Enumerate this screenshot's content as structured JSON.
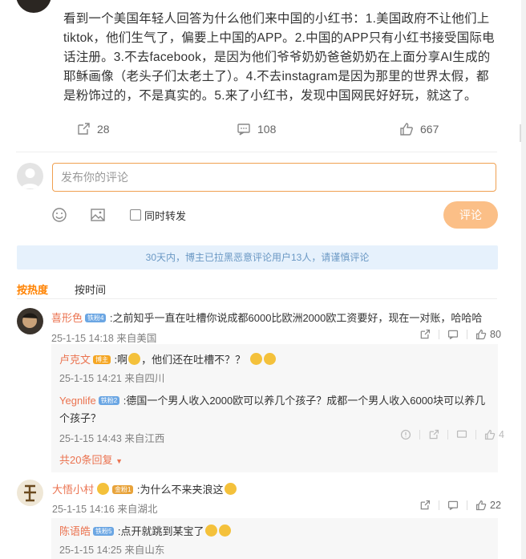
{
  "post": {
    "text": "看到一个美国年轻人回答为什么他们来中国的小红书：1.美国政府不让他们上tiktok，他们生气了，偏要上中国的APP。2.中国的APP只有小红书接受国际电话注册。3.不去facebook，是因为他们爷爷奶奶爸爸奶奶在上面分享AI生成的耶稣画像（老头子们太老土了）。4.不去instagram是因为那里的世界太假，都是粉饰过的，不是真实的。5.来了小红书，发现中国网民好好玩，就这了。",
    "reposts": "28",
    "comments": "108",
    "likes": "667"
  },
  "composer": {
    "placeholder": "发布你的评论",
    "also_repost": "同时转发",
    "submit": "评论"
  },
  "notice": "30天内，博主已拉黑恶意评论用户13人，请谨慎评论",
  "tabs": {
    "hot": "按热度",
    "time": "按时间"
  },
  "comments": [
    {
      "user": "喜形色",
      "badge": "铁粉4",
      "text": ":之前知乎一直在吐槽你说成都6000比欧洲2000欧工资要好，现在一对账，哈哈哈",
      "time": "25-1-15 14:18",
      "loc": "来自美国",
      "likes": "80",
      "replies": [
        {
          "user": "卢克文",
          "badge": "博主",
          "text": ":啊",
          "text2": "，他们还在吐槽不？？",
          "time": "25-1-15 14:21",
          "loc": "来自四川"
        },
        {
          "user": "Yegnlife",
          "badge": "铁粉2",
          "text": ":德国一个男人收入2000欧可以养几个孩子？成都一个男人收入6000块可以养几个孩子？",
          "time": "25-1-15 14:43",
          "loc": "来自江西",
          "likes": "4"
        }
      ],
      "more": "共20条回复"
    },
    {
      "user": "大悟小村",
      "badge": "金粉1",
      "text": ":为什么不来夹浪这",
      "time": "25-1-15 14:16",
      "loc": "来自湖北",
      "likes": "22",
      "replies": [
        {
          "user": "陈语皓",
          "badge": "铁粉5",
          "text": ":点开就跳到某宝了",
          "time": "25-1-15 14:25",
          "loc": "来自山东"
        }
      ]
    }
  ],
  "colors": {
    "accent": "#ff8200",
    "username": "#eb7350",
    "link": "#3d7fc9",
    "notice_bg": "#e6f1fc"
  }
}
